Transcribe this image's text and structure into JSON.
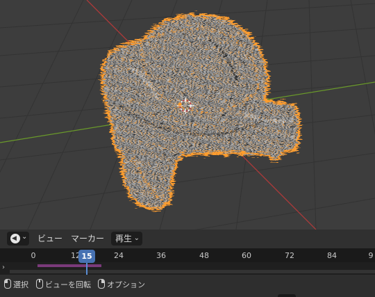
{
  "header": {
    "editor_type_icon": "clock-icon",
    "menu_view": "ビュー",
    "menu_marker": "マーカー",
    "playback_label": "再生"
  },
  "timeline": {
    "current_frame": "15",
    "ticks": [
      "0",
      "12",
      "24",
      "36",
      "48",
      "60",
      "72",
      "84",
      "9"
    ]
  },
  "status": {
    "select_label": "選択",
    "rotate_view_label": "ビューを回転",
    "options_label": "オプション"
  },
  "colors": {
    "selection_outline": "#ff9d2e",
    "mesh": "#8c8c8c",
    "x_axis": "#c23c3c",
    "y_axis": "#6a9a2a",
    "grid": "#3b3b3b",
    "playhead": "#4772b3",
    "frame_range": "#7a3a7a"
  }
}
